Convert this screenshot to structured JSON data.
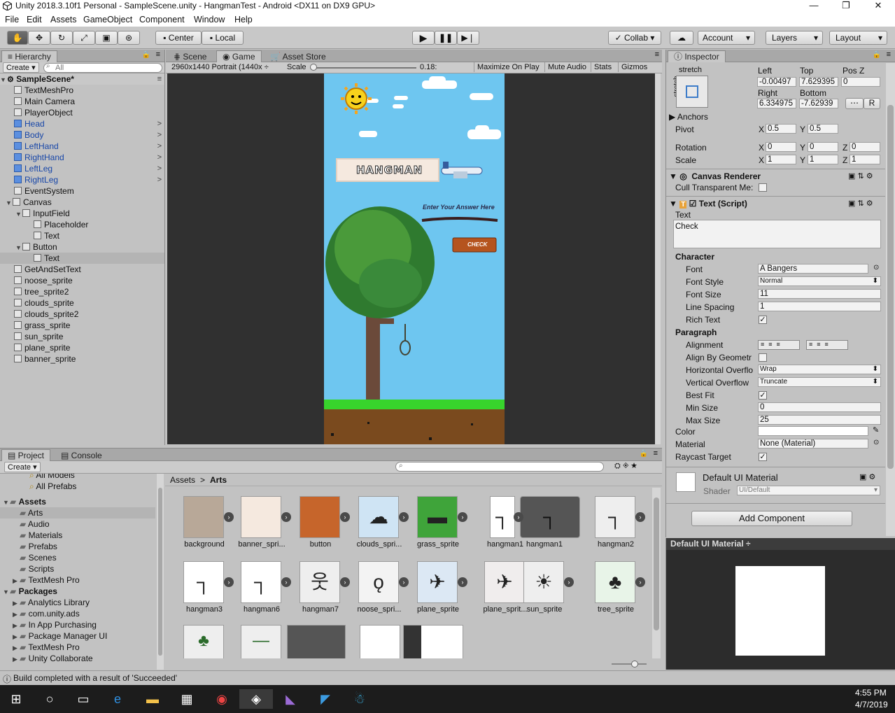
{
  "window": {
    "title": "Unity 2018.3.10f1 Personal - SampleScene.unity - HangmanTest - Android <DX11 on DX9 GPU>",
    "min": "—",
    "max": "❐",
    "close": "✕"
  },
  "menu": [
    "File",
    "Edit",
    "Assets",
    "GameObject",
    "Component",
    "Window",
    "Help"
  ],
  "toolbar": {
    "center": "Center",
    "local": "Local",
    "collab": "Collab ▾",
    "account": "Account",
    "layers": "Layers",
    "layout": "Layout"
  },
  "hierarchy": {
    "tab": "Hierarchy",
    "create": "Create ▾",
    "search_placeholder": "All",
    "scene": "SampleScene*",
    "items": [
      "TextMeshPro",
      "Main Camera",
      "PlayerObject",
      "Head",
      "Body",
      "LeftHand",
      "RightHand",
      "LeftLeg",
      "RightLeg",
      "EventSystem",
      "Canvas",
      "InputField",
      "Placeholder",
      "Text",
      "Button",
      "Text",
      "GetAndSetText",
      "noose_sprite",
      "tree_sprite2",
      "clouds_sprite",
      "clouds_sprite2",
      "grass_sprite",
      "sun_sprite",
      "plane_sprite",
      "banner_sprite"
    ]
  },
  "game": {
    "tabs": [
      "Scene",
      "Game",
      "Asset Store"
    ],
    "resolution": "2960x1440 Portrait (1440x ÷",
    "scale_label": "Scale",
    "scale_value": "0.18:",
    "maximize": "Maximize On Play",
    "mute": "Mute Audio",
    "stats": "Stats",
    "gizmos": "Gizmos",
    "banner_text": "HANGMAN",
    "prompt": "Enter Your Answer Here",
    "check": "CHECK"
  },
  "inspector": {
    "tab": "Inspector",
    "stretch": "stretch",
    "left_label": "Left",
    "top_label": "Top",
    "posz_label": "Pos Z",
    "left": "-0.00497",
    "top": "7.629395",
    "posz": "0",
    "right_label": "Right",
    "bottom_label": "Bottom",
    "right": "6.334975",
    "bottom": "-7.62939",
    "r_btn": "R",
    "anchors": "Anchors",
    "pivot": "Pivot",
    "pivot_x": "0.5",
    "pivot_y": "0.5",
    "rotation": "Rotation",
    "rot_x": "0",
    "rot_y": "0",
    "rot_z": "0",
    "scale": "Scale",
    "sc_x": "1",
    "sc_y": "1",
    "sc_z": "1",
    "x": "X",
    "y": "Y",
    "z": "Z",
    "canvas_renderer": "Canvas Renderer",
    "cull": "Cull Transparent Me:",
    "text_script": "Text (Script)",
    "text_label": "Text",
    "text_value": "Check",
    "character": "Character",
    "font_label": "Font",
    "font": "Bangers",
    "font_style_label": "Font Style",
    "font_style": "Normal",
    "font_size_label": "Font Size",
    "font_size": "11",
    "line_spacing_label": "Line Spacing",
    "line_spacing": "1",
    "rich_text_label": "Rich Text",
    "paragraph": "Paragraph",
    "alignment_label": "Alignment",
    "align_geom_label": "Align By Geometr",
    "hoverflow_label": "Horizontal Overflo",
    "hoverflow": "Wrap",
    "voverflow_label": "Vertical Overflow",
    "voverflow": "Truncate",
    "bestfit_label": "Best Fit",
    "minsize_label": "Min Size",
    "minsize": "0",
    "maxsize_label": "Max Size",
    "maxsize": "25",
    "color_label": "Color",
    "material_label": "Material",
    "material": "None (Material)",
    "raycast_label": "Raycast Target",
    "default_mat": "Default UI Material",
    "shader_label": "Shader",
    "shader": "UI/Default",
    "add_component": "Add Component",
    "preview_title": "Default UI Material ÷"
  },
  "project": {
    "tabs": [
      "Project",
      "Console"
    ],
    "create": "Create ▾",
    "tree": [
      "All Models",
      "All Prefabs",
      "Assets",
      "Arts",
      "Audio",
      "Materials",
      "Prefabs",
      "Scenes",
      "Scripts",
      "TextMesh Pro",
      "Packages",
      "Analytics Library",
      "com.unity.ads",
      "In App Purchasing",
      "Package Manager UI",
      "TextMesh Pro",
      "Unity Collaborate"
    ],
    "breadcrumb": [
      "Assets",
      "Arts"
    ],
    "assets_row1": [
      "background",
      "banner_spri...",
      "button",
      "clouds_spri...",
      "grass_sprite",
      "hangman1",
      "hangman1",
      "hangman2"
    ],
    "assets_row2": [
      "hangman3",
      "hangman6",
      "hangman7",
      "noose_spri...",
      "plane_sprite",
      "plane_sprit...",
      "sun_sprite",
      "tree_sprite"
    ]
  },
  "status": "Build completed with a result of 'Succeeded'",
  "clock": {
    "time": "4:55 PM",
    "date": "4/7/2019"
  }
}
